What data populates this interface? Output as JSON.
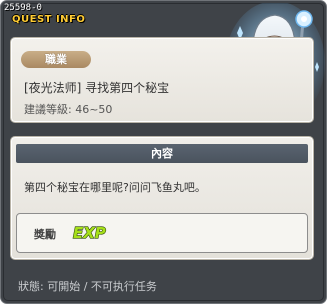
{
  "window": {
    "quest_id": "25598-0",
    "title": "QUEST INFO"
  },
  "header": {
    "job_badge": "職業",
    "quest_title": "[夜光法师] 寻找第四个秘宝",
    "level_label": "建議等級:",
    "level_range": "46~50"
  },
  "content": {
    "section_header": "內容",
    "description": "第四个秘宝在哪里呢?问问飞鱼丸吧。"
  },
  "reward": {
    "label": "獎勵",
    "exp_text": "EXP"
  },
  "status": {
    "text": "狀態: 可開始 / 不可执行任务"
  },
  "colors": {
    "title_yellow": "#ffcc33",
    "badge_tan": "#b89a72",
    "section_header_bg": "#525b66",
    "exp_green": "#a6e01a"
  }
}
